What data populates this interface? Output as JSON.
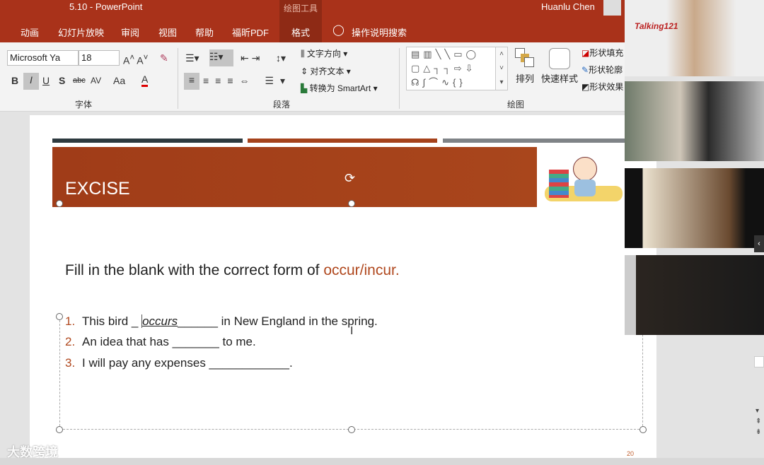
{
  "app": {
    "title": "5.10  -  PowerPoint",
    "context_tab_group": "绘图工具",
    "user": "Huanlu Chen"
  },
  "tabs": [
    "动画",
    "幻灯片放映",
    "审阅",
    "视图",
    "帮助",
    "福昕PDF",
    "格式"
  ],
  "tell_me": "操作说明搜索",
  "ribbon": {
    "font_name": "Microsoft Ya",
    "font_size": "18",
    "font_group": "字体",
    "paragraph_group": "段落",
    "drawing_group": "绘图",
    "text_direction": "文字方向",
    "align_text": "对齐文本",
    "convert_smartart": "转换为 SmartArt",
    "arrange": "排列",
    "quick_styles": "快速样式",
    "shape_fill": "形状填充",
    "shape_outline": "形状轮廓",
    "shape_effects": "形状效果",
    "format_buttons": {
      "bold": "B",
      "italic": "I",
      "underline": "U",
      "shadow": "S",
      "strike": "abc",
      "spacing": "AV",
      "case": "Aa",
      "color": "A"
    }
  },
  "slide": {
    "title": "EXCISE",
    "heading": "Fill in the blank with the correct form of ",
    "heading_accent": "occur/incur.",
    "items": [
      {
        "num": "1.",
        "before": "This bird _ ",
        "answer": "occurs",
        "after": "______ in New England in the spring."
      },
      {
        "num": "2.",
        "before": "An idea that has _______ to me.",
        "answer": "",
        "after": ""
      },
      {
        "num": "3.",
        "before": "I will pay any expenses ____________.",
        "answer": "",
        "after": ""
      }
    ],
    "page_number": "20"
  },
  "watermark": "大数跨境",
  "video_participants": [
    "Talking121"
  ],
  "colors": {
    "brand": "#a9321a",
    "accent": "#b0481e"
  }
}
